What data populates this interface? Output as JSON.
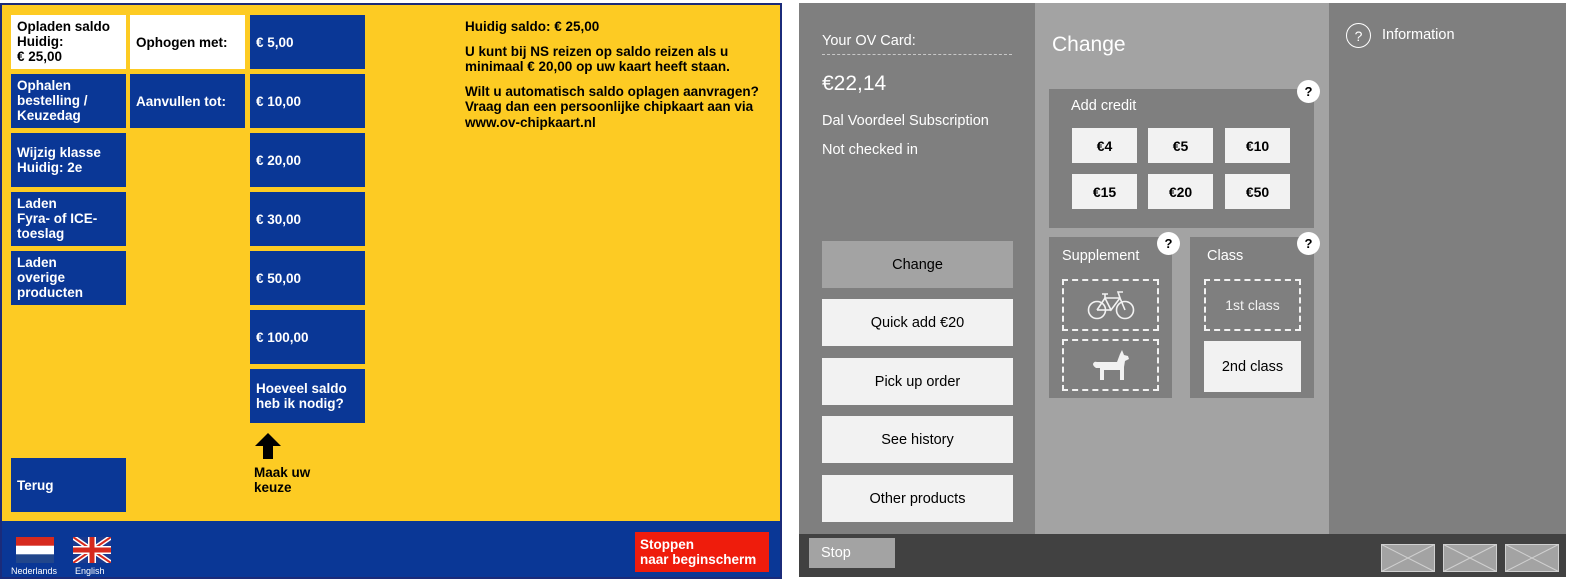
{
  "left_panel": {
    "menu": [
      {
        "id": "opladen",
        "lines": [
          "Opladen saldo",
          "Huidig:",
          "€ 25,00"
        ]
      },
      {
        "id": "ophalen",
        "lines": [
          "Ophalen",
          "bestelling /",
          "Keuzedag"
        ]
      },
      {
        "id": "klasse",
        "lines": [
          "Wijzig klasse",
          "Huidig: 2e"
        ]
      },
      {
        "id": "laden-fyra",
        "lines": [
          "Laden",
          "Fyra- of ICE-",
          "toeslag"
        ]
      },
      {
        "id": "laden-overige",
        "lines": [
          "Laden",
          "overige",
          "producten"
        ]
      }
    ],
    "back_label": "Terug",
    "modes": {
      "ophogen": "Ophogen met:",
      "aanvullen": "Aanvullen tot:"
    },
    "amounts": [
      "€ 5,00",
      "€ 10,00",
      "€ 20,00",
      "€ 30,00",
      "€ 50,00",
      "€ 100,00"
    ],
    "help": {
      "lines": [
        "Hoeveel saldo",
        "heb ik nodig?"
      ]
    },
    "instruction": {
      "lines": [
        "Maak uw",
        "keuze"
      ]
    },
    "info": {
      "balance": "Huidig saldo: € 25,00",
      "p1": [
        "U kunt bij NS reizen op saldo reizen als u",
        "minimaal € 20,00 op uw kaart heeft staan."
      ],
      "p2": [
        "Wilt u automatisch saldo oplagen aanvragen?",
        "Vraag dan een persoonlijke chipkaart aan via",
        "www.ov-chipkaart.nl"
      ]
    },
    "languages": {
      "nl": "Nederlands",
      "en": "English"
    },
    "stop": {
      "lines": [
        "Stoppen",
        "naar beginscherm"
      ]
    },
    "colors": {
      "background": "#fdcb23",
      "blue": "#0a3796",
      "stop": "#ef1c0c"
    }
  },
  "right_panel": {
    "card_label": "Your OV Card:",
    "balance": "€22,14",
    "subscription": "Dal Voordeel Subscription",
    "checkin_status": "Not checked in",
    "menu": [
      "Change",
      "Quick add €20",
      "Pick up order",
      "See history",
      "Other products"
    ],
    "active_menu": "Change",
    "heading": "Change",
    "add_credit": {
      "label": "Add credit",
      "amounts": [
        "€4",
        "€5",
        "€10",
        "€15",
        "€20",
        "€50"
      ]
    },
    "supplement": {
      "label": "Supplement",
      "options": [
        "bicycle-icon",
        "dog-icon"
      ]
    },
    "class": {
      "label": "Class",
      "first": "1st class",
      "second": "2nd class",
      "selected": "2nd class"
    },
    "help_symbol": "?",
    "info_label": "Information",
    "stop_label": "Stop",
    "colors": {
      "dark": "#7f7f7f",
      "mid": "#a3a3a3",
      "bar": "#414141",
      "light": "#f2f2f2"
    }
  }
}
